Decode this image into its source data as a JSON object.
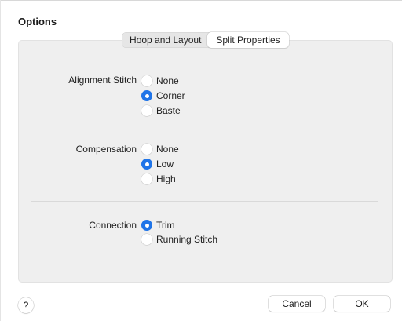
{
  "dialog": {
    "title": "Options"
  },
  "tabs": [
    {
      "label": "Hoop and Layout",
      "selected": false
    },
    {
      "label": "Split Properties",
      "selected": true
    }
  ],
  "groups": {
    "alignment": {
      "label": "Alignment Stitch",
      "options": [
        {
          "label": "None",
          "checked": false
        },
        {
          "label": "Corner",
          "checked": true
        },
        {
          "label": "Baste",
          "checked": false
        }
      ]
    },
    "compensation": {
      "label": "Compensation",
      "options": [
        {
          "label": "None",
          "checked": false
        },
        {
          "label": "Low",
          "checked": true
        },
        {
          "label": "High",
          "checked": false
        }
      ]
    },
    "connection": {
      "label": "Connection",
      "options": [
        {
          "label": "Trim",
          "checked": true
        },
        {
          "label": "Running Stitch",
          "checked": false
        }
      ]
    }
  },
  "footer": {
    "help_label": "?",
    "cancel_label": "Cancel",
    "ok_label": "OK"
  },
  "colors": {
    "accent": "#1f74e8",
    "panel_background": "#efefef"
  }
}
